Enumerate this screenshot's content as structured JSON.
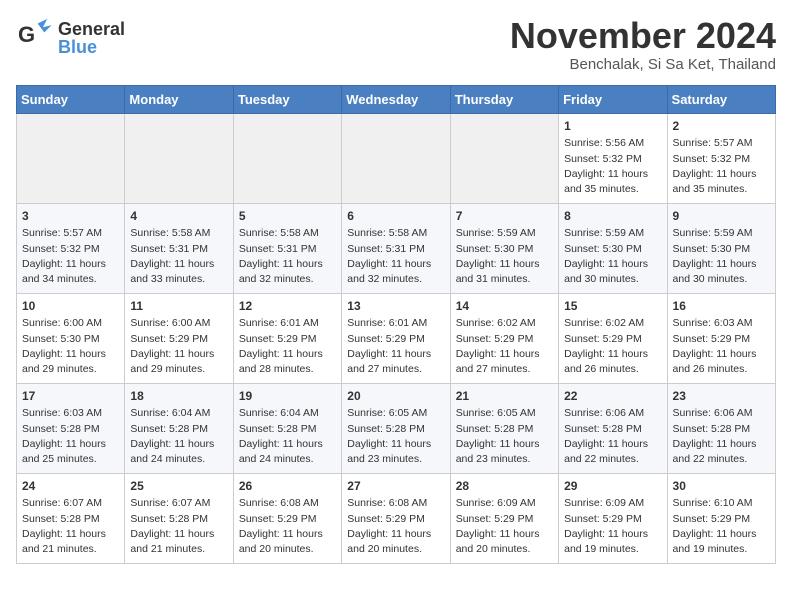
{
  "header": {
    "logo_general": "General",
    "logo_blue": "Blue",
    "title": "November 2024",
    "subtitle": "Benchalak, Si Sa Ket, Thailand"
  },
  "days_of_week": [
    "Sunday",
    "Monday",
    "Tuesday",
    "Wednesday",
    "Thursday",
    "Friday",
    "Saturday"
  ],
  "weeks": [
    {
      "days": [
        {
          "num": "",
          "info": ""
        },
        {
          "num": "",
          "info": ""
        },
        {
          "num": "",
          "info": ""
        },
        {
          "num": "",
          "info": ""
        },
        {
          "num": "",
          "info": ""
        },
        {
          "num": "1",
          "info": "Sunrise: 5:56 AM\nSunset: 5:32 PM\nDaylight: 11 hours\nand 35 minutes."
        },
        {
          "num": "2",
          "info": "Sunrise: 5:57 AM\nSunset: 5:32 PM\nDaylight: 11 hours\nand 35 minutes."
        }
      ]
    },
    {
      "days": [
        {
          "num": "3",
          "info": "Sunrise: 5:57 AM\nSunset: 5:32 PM\nDaylight: 11 hours\nand 34 minutes."
        },
        {
          "num": "4",
          "info": "Sunrise: 5:58 AM\nSunset: 5:31 PM\nDaylight: 11 hours\nand 33 minutes."
        },
        {
          "num": "5",
          "info": "Sunrise: 5:58 AM\nSunset: 5:31 PM\nDaylight: 11 hours\nand 32 minutes."
        },
        {
          "num": "6",
          "info": "Sunrise: 5:58 AM\nSunset: 5:31 PM\nDaylight: 11 hours\nand 32 minutes."
        },
        {
          "num": "7",
          "info": "Sunrise: 5:59 AM\nSunset: 5:30 PM\nDaylight: 11 hours\nand 31 minutes."
        },
        {
          "num": "8",
          "info": "Sunrise: 5:59 AM\nSunset: 5:30 PM\nDaylight: 11 hours\nand 30 minutes."
        },
        {
          "num": "9",
          "info": "Sunrise: 5:59 AM\nSunset: 5:30 PM\nDaylight: 11 hours\nand 30 minutes."
        }
      ]
    },
    {
      "days": [
        {
          "num": "10",
          "info": "Sunrise: 6:00 AM\nSunset: 5:30 PM\nDaylight: 11 hours\nand 29 minutes."
        },
        {
          "num": "11",
          "info": "Sunrise: 6:00 AM\nSunset: 5:29 PM\nDaylight: 11 hours\nand 29 minutes."
        },
        {
          "num": "12",
          "info": "Sunrise: 6:01 AM\nSunset: 5:29 PM\nDaylight: 11 hours\nand 28 minutes."
        },
        {
          "num": "13",
          "info": "Sunrise: 6:01 AM\nSunset: 5:29 PM\nDaylight: 11 hours\nand 27 minutes."
        },
        {
          "num": "14",
          "info": "Sunrise: 6:02 AM\nSunset: 5:29 PM\nDaylight: 11 hours\nand 27 minutes."
        },
        {
          "num": "15",
          "info": "Sunrise: 6:02 AM\nSunset: 5:29 PM\nDaylight: 11 hours\nand 26 minutes."
        },
        {
          "num": "16",
          "info": "Sunrise: 6:03 AM\nSunset: 5:29 PM\nDaylight: 11 hours\nand 26 minutes."
        }
      ]
    },
    {
      "days": [
        {
          "num": "17",
          "info": "Sunrise: 6:03 AM\nSunset: 5:28 PM\nDaylight: 11 hours\nand 25 minutes."
        },
        {
          "num": "18",
          "info": "Sunrise: 6:04 AM\nSunset: 5:28 PM\nDaylight: 11 hours\nand 24 minutes."
        },
        {
          "num": "19",
          "info": "Sunrise: 6:04 AM\nSunset: 5:28 PM\nDaylight: 11 hours\nand 24 minutes."
        },
        {
          "num": "20",
          "info": "Sunrise: 6:05 AM\nSunset: 5:28 PM\nDaylight: 11 hours\nand 23 minutes."
        },
        {
          "num": "21",
          "info": "Sunrise: 6:05 AM\nSunset: 5:28 PM\nDaylight: 11 hours\nand 23 minutes."
        },
        {
          "num": "22",
          "info": "Sunrise: 6:06 AM\nSunset: 5:28 PM\nDaylight: 11 hours\nand 22 minutes."
        },
        {
          "num": "23",
          "info": "Sunrise: 6:06 AM\nSunset: 5:28 PM\nDaylight: 11 hours\nand 22 minutes."
        }
      ]
    },
    {
      "days": [
        {
          "num": "24",
          "info": "Sunrise: 6:07 AM\nSunset: 5:28 PM\nDaylight: 11 hours\nand 21 minutes."
        },
        {
          "num": "25",
          "info": "Sunrise: 6:07 AM\nSunset: 5:28 PM\nDaylight: 11 hours\nand 21 minutes."
        },
        {
          "num": "26",
          "info": "Sunrise: 6:08 AM\nSunset: 5:29 PM\nDaylight: 11 hours\nand 20 minutes."
        },
        {
          "num": "27",
          "info": "Sunrise: 6:08 AM\nSunset: 5:29 PM\nDaylight: 11 hours\nand 20 minutes."
        },
        {
          "num": "28",
          "info": "Sunrise: 6:09 AM\nSunset: 5:29 PM\nDaylight: 11 hours\nand 20 minutes."
        },
        {
          "num": "29",
          "info": "Sunrise: 6:09 AM\nSunset: 5:29 PM\nDaylight: 11 hours\nand 19 minutes."
        },
        {
          "num": "30",
          "info": "Sunrise: 6:10 AM\nSunset: 5:29 PM\nDaylight: 11 hours\nand 19 minutes."
        }
      ]
    }
  ]
}
